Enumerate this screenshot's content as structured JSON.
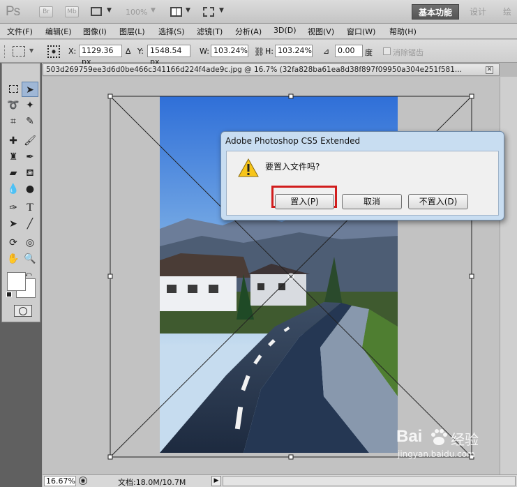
{
  "app": {
    "logo": "Ps",
    "bridge_label": "Br",
    "minibridge_label": "Mb",
    "zoom_label": "100%",
    "workspaces": [
      "基本功能",
      "设计",
      "绘画"
    ]
  },
  "menu": [
    "文件(F)",
    "编辑(E)",
    "图像(I)",
    "图层(L)",
    "选择(S)",
    "滤镜(T)",
    "分析(A)",
    "3D(D)",
    "视图(V)",
    "窗口(W)",
    "帮助(H)"
  ],
  "options": {
    "x_label": "X:",
    "x_value": "1129.36 px",
    "y_label": "Y:",
    "y_value": "1548.54 px",
    "w_label": "W:",
    "w_value": "103.24%",
    "h_label": "H:",
    "h_value": "103.24%",
    "angle_value": "0.00",
    "angle_unit": "度",
    "antialias_label": "消除锯齿"
  },
  "document": {
    "tab_title": "503d269759ee3d6d0be466c341166d224f4ade9c.jpg @ 16.7% (32fa828ba61ea8d38f897f09950a304e251f581...",
    "close": "✕"
  },
  "status": {
    "zoom": "16.67%",
    "doc_info": "文档:18.0M/10.7M"
  },
  "dialog": {
    "title": "Adobe Photoshop CS5 Extended",
    "message": "要置入文件吗?",
    "place_button": "置入(P)",
    "cancel_button": "取消",
    "dont_place_button": "不置入(D)"
  },
  "watermark": {
    "brand": "Bai",
    "brand2": "经验",
    "url": "jingyan.baidu.com"
  },
  "colors": {
    "highlight": "#d11d1d",
    "dialog_frame": "#c8ddf1"
  }
}
